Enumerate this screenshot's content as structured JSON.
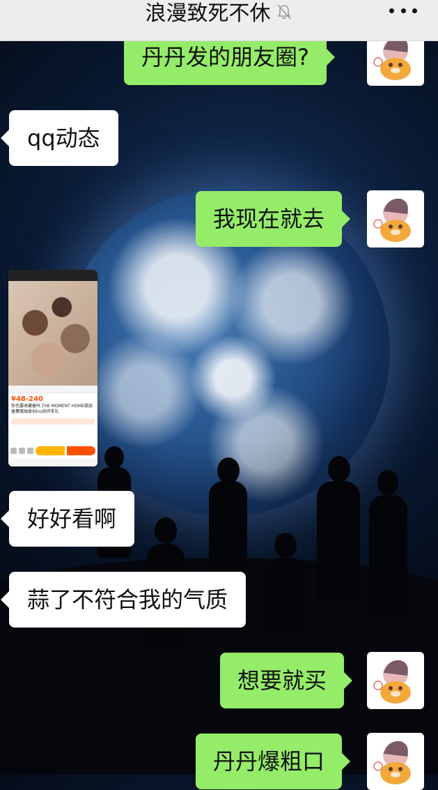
{
  "header": {
    "title": "浪漫致死不休",
    "mute_icon": "bell-off-icon",
    "more_icon": "more-dots-icon"
  },
  "messages": [
    {
      "side": "out",
      "text": "丹丹发的朋友圈?"
    },
    {
      "side": "in",
      "text": "qq动态"
    },
    {
      "side": "out",
      "text": "我现在就去"
    },
    {
      "side": "in",
      "type": "image",
      "image": {
        "price": "¥48-240",
        "desc": "你也要收藏着吗 THE MOMENT HOME甜品香薰蜡烛原创ins风伴手礼"
      }
    },
    {
      "side": "in",
      "text": "好好看啊"
    },
    {
      "side": "in",
      "text": "蒜了不符合我的气质"
    },
    {
      "side": "out",
      "text": "想要就买"
    },
    {
      "side": "out",
      "text": "丹丹爆粗口"
    }
  ],
  "colors": {
    "outgoing_bubble": "#95ec69",
    "incoming_bubble": "#ffffff",
    "titlebar": "#ededed"
  }
}
